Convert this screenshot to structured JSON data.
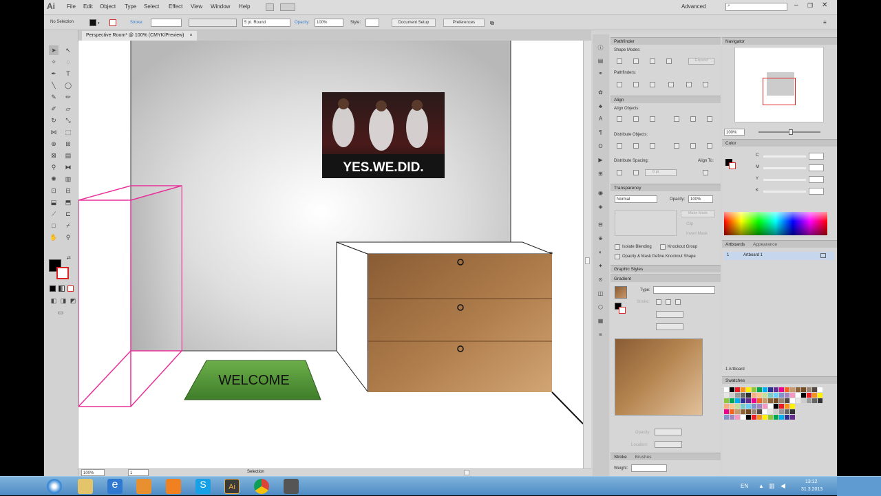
{
  "menubar": {
    "logo": "Ai",
    "items": [
      "File",
      "Edit",
      "Object",
      "Type",
      "Select",
      "Effect",
      "View",
      "Window",
      "Help"
    ],
    "workspace": "Advanced"
  },
  "control_bar": {
    "selection": "No Selection",
    "stroke_label": "Stroke:",
    "brush": "5 pt. Round",
    "opacity_label": "Opacity:",
    "opacity_value": "100%",
    "style_label": "Style:",
    "doc_setup": "Document Setup",
    "preferences": "Preferences"
  },
  "document": {
    "tab_title": "Perspective Room* @ 100% (CMYK/Preview)",
    "poster_text": "YES.WE.DID.",
    "mat_text": "WELCOME"
  },
  "status": {
    "zoom": "100%",
    "artboard_num": "1",
    "tool": "Selection"
  },
  "pathfinder": {
    "title": "Pathfinder",
    "shape_modes": "Shape Modes:",
    "pathfinders": "Pathfinders:",
    "expand": "Expand"
  },
  "align": {
    "title": "Align",
    "align_objects": "Align Objects:",
    "distribute_objects": "Distribute Objects:",
    "distribute_spacing": "Distribute Spacing:",
    "align_to": "Align To:",
    "spacing_value": "0 pt"
  },
  "transparency": {
    "title": "Transparency",
    "mode": "Normal",
    "opacity_label": "Opacity:",
    "opacity_value": "100%",
    "make_mask": "Make Mask",
    "clip": "Clip",
    "invert_mask": "Invert Mask",
    "isolate": "Isolate Blending",
    "knockout": "Knockout Group",
    "opacity_mask": "Opacity & Mask Define Knockout Shape"
  },
  "graphic_styles": {
    "title": "Graphic Styles"
  },
  "gradient": {
    "title": "Gradient",
    "type_label": "Type:",
    "stroke_label": "Stroke:",
    "opacity_label": "Opacity:",
    "location_label": "Location:",
    "start_color": "#5c3d20",
    "end_color": "#b88a5a"
  },
  "stroke_panel": {
    "title": "Stroke",
    "brushes_tab": "Brushes",
    "weight_label": "Weight:"
  },
  "navigator": {
    "title": "Navigator",
    "zoom": "100%"
  },
  "color": {
    "title": "Color",
    "channels": [
      "C",
      "M",
      "Y",
      "K"
    ]
  },
  "artboards": {
    "tab_artboards": "Artboards",
    "tab_appearance": "Appearance",
    "row_num": "1",
    "row_name": "Artboard 1",
    "footer": "1 Artboard"
  },
  "swatches": {
    "title": "Swatches"
  },
  "taskbar": {
    "lang": "EN",
    "time": "13:12",
    "date": "31.3.2013"
  },
  "colors": {
    "magenta_outline": "#e8309a",
    "wood_light": "#c89866",
    "wood_dark": "#8a5c34",
    "mat_green": "#5a9a3a"
  }
}
